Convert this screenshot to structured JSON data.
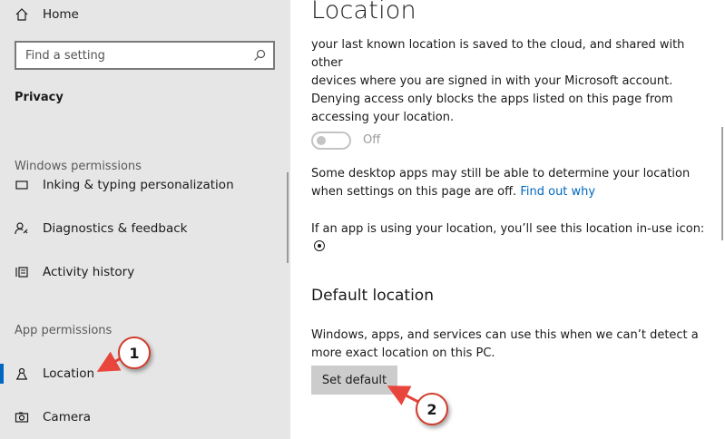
{
  "sidebar": {
    "home_label": "Home",
    "search_placeholder": "Find a setting",
    "section_title": "Privacy",
    "windows_permissions_label": "Windows permissions",
    "partial_item_label": "Inking & typing personalization",
    "items": [
      {
        "label": "Diagnostics & feedback",
        "icon": "feedback-icon"
      },
      {
        "label": "Activity history",
        "icon": "activity-history-icon"
      }
    ],
    "app_permissions_label": "App permissions",
    "app_items": [
      {
        "label": "Location",
        "icon": "location-icon",
        "active": true
      },
      {
        "label": "Camera",
        "icon": "camera-icon"
      }
    ]
  },
  "main": {
    "title": "Location",
    "intro_lines": [
      "your last known location is saved to the cloud, and shared with other",
      "devices where you are signed in with your Microsoft account.",
      "Denying access only blocks the apps listed on this page from",
      "accessing your location."
    ],
    "toggle_state": "Off",
    "desktop_apps_line1": "Some desktop apps may still be able to determine your location",
    "desktop_apps_line2": "when settings on this page are off.",
    "find_out_why": "Find out why",
    "in_use_text": "If an app is using your location, you’ll see this location in-use icon:",
    "default_location_heading": "Default location",
    "default_location_lines": [
      "Windows, apps, and services can use this when we can’t detect a",
      "more exact location on this PC."
    ],
    "set_default_label": "Set default"
  },
  "annotations": {
    "one": "1",
    "two": "2"
  },
  "colors": {
    "sidebar_bg": "#e6e6e6",
    "accent": "#0067c0",
    "annotation_border": "#d23c2c"
  }
}
